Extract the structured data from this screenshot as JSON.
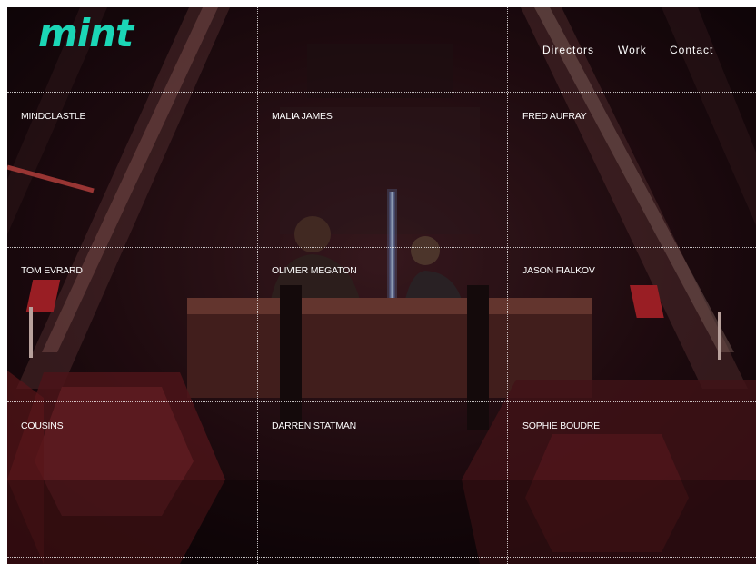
{
  "brand": {
    "logo": "mint",
    "accent_color": "#1bd6b6"
  },
  "nav": {
    "items": [
      "Directors",
      "Work",
      "Contact"
    ]
  },
  "directors": [
    "MINDCLASTLE",
    "MALIA JAMES",
    "FRED AUFRAY",
    "TOM EVRARD",
    "OLIVIER MEGATON",
    "JASON FIALKOV",
    "COUSINS",
    "DARREN STATMAN",
    "SOPHIE BOUDRE"
  ],
  "background": {
    "description_icon": "spaceship-interior-scene",
    "colors": {
      "base": "#1e0a0f",
      "glow_red": "#c8282f",
      "saber_blue": "#b9dcff"
    }
  }
}
